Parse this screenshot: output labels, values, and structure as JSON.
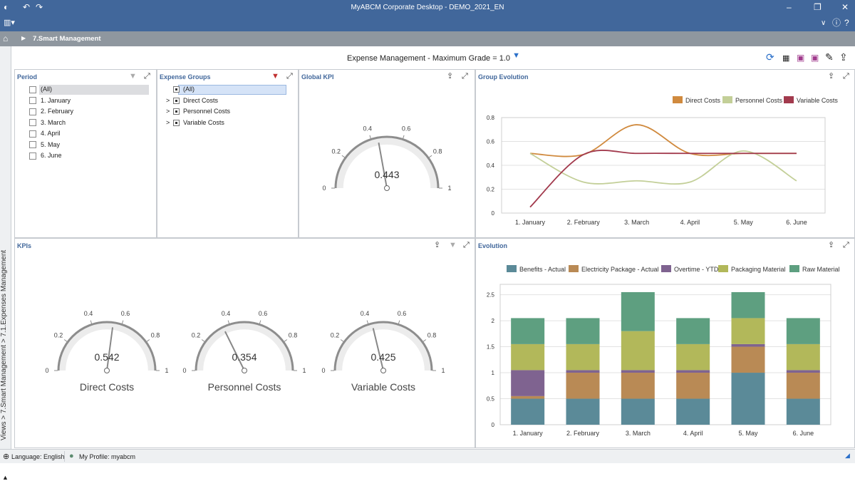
{
  "window": {
    "title": "MyABCM Corporate Desktop - DEMO_2021_EN"
  },
  "nav": {
    "breadcrumb": "7.Smart Management"
  },
  "sidebar": {
    "path": "Views > 7.Smart Management > 7.1.Expenses Management"
  },
  "header": {
    "title": "Expense Management -  Maximum Grade = 1.0"
  },
  "period": {
    "title": "Period",
    "items": [
      "(All)",
      "1. January",
      "2. February",
      "3. March",
      "4. April",
      "5. May",
      "6. June"
    ]
  },
  "groups": {
    "title": "Expense Groups",
    "items": [
      "(All)",
      "Direct Costs",
      "Personnel Costs",
      "Variable Costs"
    ]
  },
  "global_kpi": {
    "title": "Global KPI",
    "value": "0.443",
    "value_num": 0.443,
    "ticks": [
      {
        "v": 0,
        "label": "0"
      },
      {
        "v": 0.2,
        "label": "0.2"
      },
      {
        "v": 0.4,
        "label": "0.4"
      },
      {
        "v": 0.6,
        "label": "0.6"
      },
      {
        "v": 0.8,
        "label": "0.8"
      },
      {
        "v": 1,
        "label": "1"
      }
    ]
  },
  "kpis": {
    "title": "KPIs",
    "gauges": [
      {
        "label": "Direct Costs",
        "value": "0.542",
        "value_num": 0.542
      },
      {
        "label": "Personnel Costs",
        "value": "0.354",
        "value_num": 0.354
      },
      {
        "label": "Variable Costs",
        "value": "0.425",
        "value_num": 0.425
      }
    ]
  },
  "colors": {
    "direct": "#d08a3e",
    "personnel": "#c3cf98",
    "variable": "#a23a4d",
    "benefits": "#5b8a98",
    "electricity": "#b98a55",
    "overtime": "#7f6390",
    "packaging": "#b2b85a",
    "raw": "#5e9f80"
  },
  "chart_data": [
    {
      "type": "line",
      "title": "Group Evolution",
      "categories": [
        "1. January",
        "2. February",
        "3. March",
        "4. April",
        "5. May",
        "6. June"
      ],
      "ylim": [
        0,
        0.8
      ],
      "yticks": [
        "0",
        "0.2",
        "0.4",
        "0.6",
        "0.8"
      ],
      "legend": "top-right",
      "grid": true,
      "series": [
        {
          "name": "Direct Costs",
          "values": [
            0.5,
            0.49,
            0.74,
            0.5,
            0.5,
            0.5
          ]
        },
        {
          "name": "Personnel Costs",
          "values": [
            0.5,
            0.26,
            0.27,
            0.26,
            0.52,
            0.27
          ]
        },
        {
          "name": "Variable Costs",
          "values": [
            0.05,
            0.49,
            0.5,
            0.5,
            0.5,
            0.5
          ]
        }
      ]
    },
    {
      "type": "bar",
      "stacked": true,
      "title": "Evolution",
      "categories": [
        "1. January",
        "2. February",
        "3. March",
        "4. April",
        "5. May",
        "6. June"
      ],
      "ylim": [
        0,
        2.7
      ],
      "yticks": [
        "0",
        "0.5",
        "1",
        "1.5",
        "2",
        "2.5"
      ],
      "legend": "top",
      "grid": true,
      "series": [
        {
          "name": "Benefits - Actual",
          "values": [
            0.5,
            0.5,
            0.5,
            0.5,
            1.0,
            0.5
          ]
        },
        {
          "name": "Electricity Package - Actual",
          "values": [
            0.05,
            0.5,
            0.5,
            0.5,
            0.5,
            0.5
          ]
        },
        {
          "name": "Overtime - YTD",
          "values": [
            0.5,
            0.05,
            0.05,
            0.05,
            0.05,
            0.05
          ]
        },
        {
          "name": "Packaging Material",
          "values": [
            0.5,
            0.5,
            0.75,
            0.5,
            0.5,
            0.5
          ]
        },
        {
          "name": "Raw Material",
          "values": [
            0.5,
            0.5,
            0.75,
            0.5,
            0.5,
            0.5
          ]
        }
      ]
    }
  ],
  "status": {
    "language": "Language: English",
    "profile": "My Profile: myabcm"
  }
}
